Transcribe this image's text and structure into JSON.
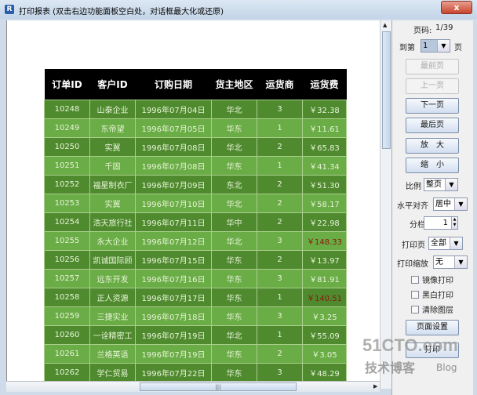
{
  "window": {
    "title": "打印报表   (双击右边功能面板空白处，对话框最大化或还原)",
    "close_label": "x"
  },
  "table": {
    "headers": [
      "订单ID",
      "客户ID",
      "订购日期",
      "货主地区",
      "运货商",
      "运货费"
    ],
    "rows": [
      [
        "10248",
        "山泰企业",
        "1996年07月04日",
        "华北",
        "3",
        "￥32.38"
      ],
      [
        "10249",
        "东帝望",
        "1996年07月05日",
        "华东",
        "1",
        "￥11.61"
      ],
      [
        "10250",
        "实翼",
        "1996年07月08日",
        "华北",
        "2",
        "￥65.83"
      ],
      [
        "10251",
        "千固",
        "1996年07月08日",
        "华东",
        "1",
        "￥41.34"
      ],
      [
        "10252",
        "福星制衣厂",
        "1996年07月09日",
        "东北",
        "2",
        "￥51.30"
      ],
      [
        "10253",
        "实翼",
        "1996年07月10日",
        "华北",
        "2",
        "￥58.17"
      ],
      [
        "10254",
        "浩天旅行社",
        "1996年07月11日",
        "华中",
        "2",
        "￥22.98"
      ],
      [
        "10255",
        "永大企业",
        "1996年07月12日",
        "华北",
        "3",
        "￥148.33"
      ],
      [
        "10256",
        "凯诚国际顾",
        "1996年07月15日",
        "华东",
        "2",
        "￥13.97"
      ],
      [
        "10257",
        "远东开发",
        "1996年07月16日",
        "华东",
        "3",
        "￥81.91"
      ],
      [
        "10258",
        "正人资源",
        "1996年07月17日",
        "华东",
        "1",
        "￥140.51"
      ],
      [
        "10259",
        "三捷实业",
        "1996年07月18日",
        "华东",
        "3",
        "￥3.25"
      ],
      [
        "10260",
        "一诠精密工",
        "1996年07月19日",
        "华北",
        "1",
        "￥55.09"
      ],
      [
        "10261",
        "兰格英语",
        "1996年07月19日",
        "华东",
        "2",
        "￥3.05"
      ],
      [
        "10262",
        "学仁贸易",
        "1996年07月22日",
        "华东",
        "3",
        "￥48.29"
      ]
    ],
    "highlight_rows": [
      7,
      10
    ],
    "colors": {
      "dark_row": "#4f8a2f",
      "light_row": "#6aac46",
      "header": "#000000",
      "highlight_text": "#8b1a0a"
    }
  },
  "panel": {
    "page_label": "页码:",
    "page_value": "1/39",
    "goto_label": "到第",
    "goto_value": "1",
    "goto_suffix": "页",
    "buttons": {
      "first": "最前页",
      "prev": "上一页",
      "next": "下一页",
      "last": "最后页",
      "zoom_in": "放　大",
      "zoom_out": "缩　小",
      "page_setup": "页面设置",
      "print": "打印"
    },
    "ratio_label": "比例",
    "ratio_value": "整页",
    "align_label": "水平对齐",
    "align_value": "居中",
    "columns_label": "分栏",
    "columns_value": "1",
    "print_pages_label": "打印页",
    "print_pages_value": "全部",
    "print_scale_label": "打印缩放",
    "print_scale_value": "无",
    "checkboxes": {
      "mirror": "镜像打印",
      "bw": "黑白打印",
      "clear_layers": "清除图层"
    }
  },
  "watermark": {
    "line1": "51CTO.com",
    "line2": "技术博客",
    "line3": "Blog"
  }
}
